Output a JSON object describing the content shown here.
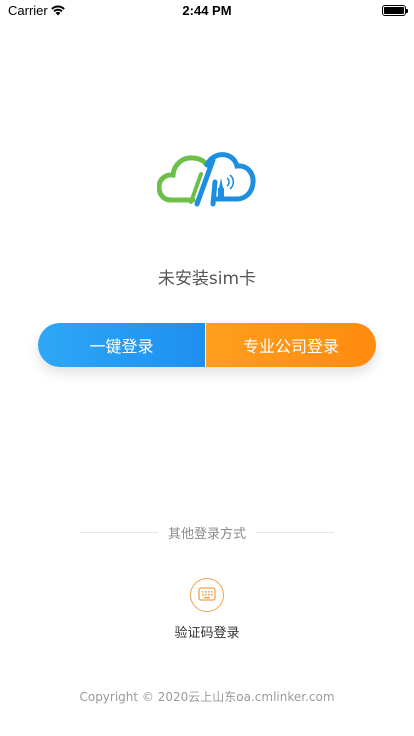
{
  "status_bar": {
    "carrier": "Carrier",
    "time": "2:44 PM",
    "wifi_icon": "wifi-icon",
    "battery_icon": "battery-icon"
  },
  "logo": {
    "icon": "cloud-logo-icon",
    "colors": {
      "green": "#6cc04a",
      "blue": "#1e8fe0"
    }
  },
  "sim_status": "未安装sim卡",
  "buttons": {
    "one_click_login": "一键登录",
    "company_login": "专业公司登录",
    "colors": {
      "left": "#2ea7f5",
      "right": "#ff9310"
    }
  },
  "other_methods": {
    "title": "其他登录方式",
    "code_login_label": "验证码登录",
    "code_login_icon": "keyboard-icon",
    "icon_color": "#f3a24a"
  },
  "footer": {
    "copyright": "Copyright © 2020云上山东oa.cmlinker.com"
  }
}
